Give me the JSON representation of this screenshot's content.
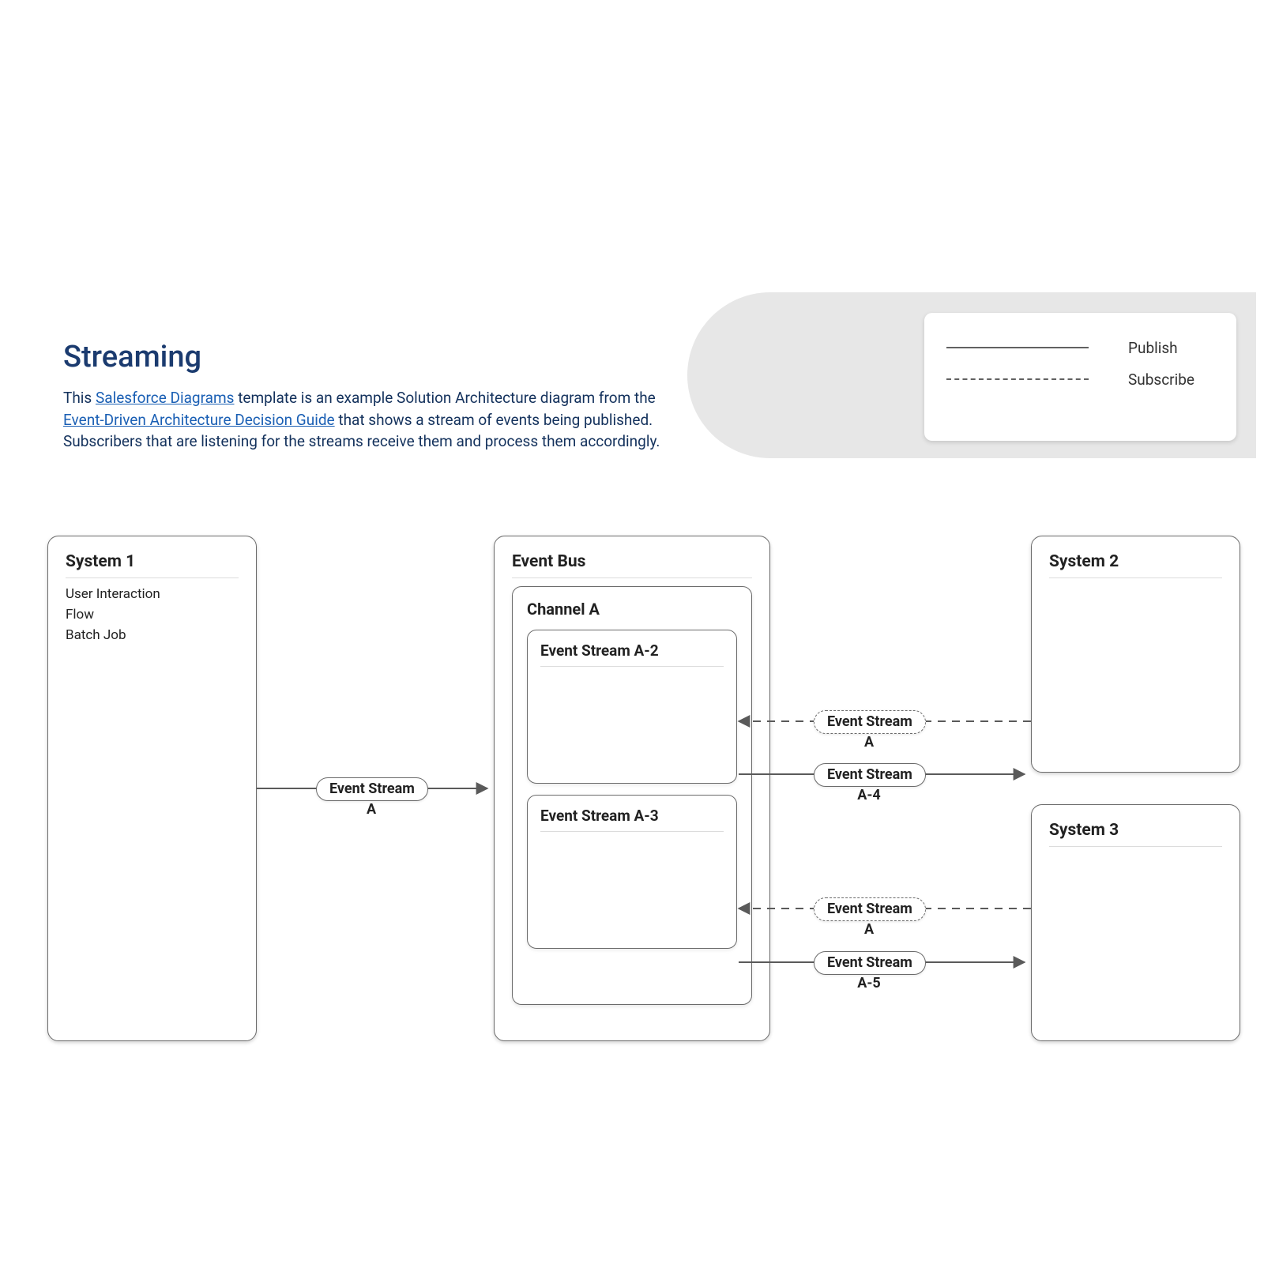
{
  "header": {
    "title": "Streaming",
    "desc_prefix": "This ",
    "link1": "Salesforce Diagrams",
    "desc_mid1": " template is an example Solution Architecture diagram from the ",
    "link2": "Event-Driven Architecture Decision Guide",
    "desc_suffix": " that shows a stream of events being published. Subscribers that are listening for the streams receive them and process them accordingly."
  },
  "legend": {
    "publish": "Publish",
    "subscribe": "Subscribe"
  },
  "nodes": {
    "system1": {
      "title": "System 1",
      "items": [
        "User Interaction",
        "Flow",
        "Batch Job"
      ]
    },
    "eventBus": {
      "title": "Event Bus"
    },
    "channelA": {
      "title": "Channel A"
    },
    "streamA2": {
      "title": "Event Stream A-2"
    },
    "streamA3": {
      "title": "Event Stream A-3"
    },
    "system2": {
      "title": "System 2"
    },
    "system3": {
      "title": "System 3"
    }
  },
  "edges": {
    "eA": {
      "label": "Event Stream",
      "sub": "A"
    },
    "sA_top": {
      "label": "Event Stream",
      "sub": "A"
    },
    "eA4": {
      "label": "Event Stream",
      "sub": "A-4"
    },
    "sA_bot": {
      "label": "Event Stream",
      "sub": "A"
    },
    "eA5": {
      "label": "Event Stream",
      "sub": "A-5"
    }
  }
}
